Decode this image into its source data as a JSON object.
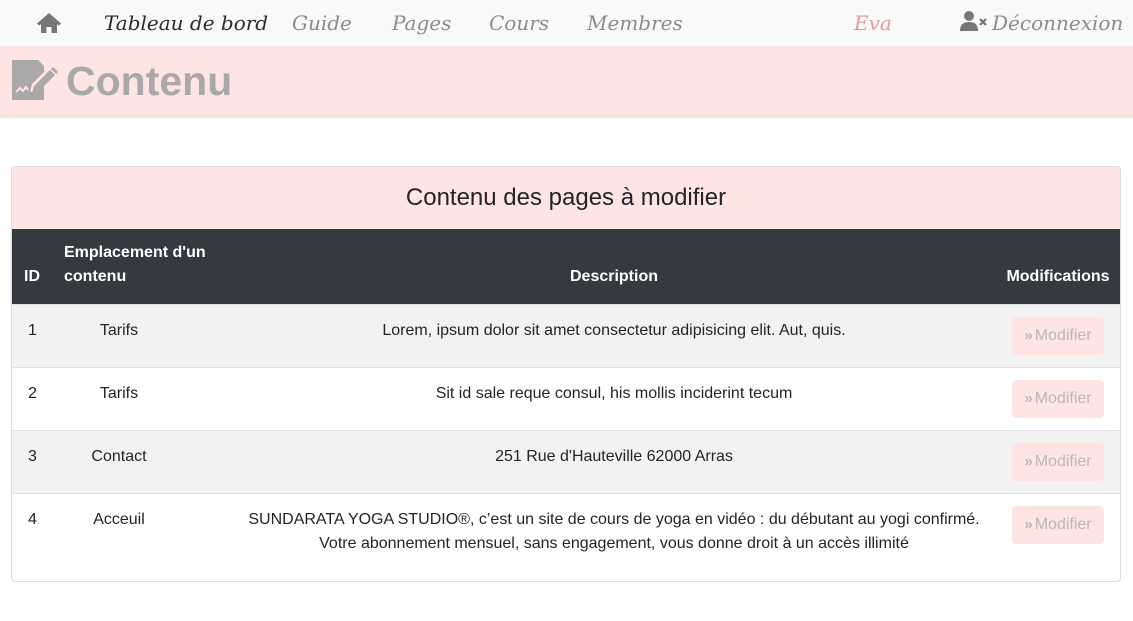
{
  "nav": {
    "home_icon": "home-icon",
    "items": [
      {
        "label": "Tableau de bord",
        "active": true
      },
      {
        "label": "Guide"
      },
      {
        "label": "Pages"
      },
      {
        "label": "Cours"
      },
      {
        "label": "Membres"
      }
    ],
    "user": "Eva",
    "logout_label": "Déconnexion",
    "logout_icon": "user-times-icon"
  },
  "header": {
    "title": "Contenu",
    "icon": "file-signature-icon"
  },
  "card": {
    "title": "Contenu des pages à modifier",
    "columns": [
      "ID",
      "Emplacement d'un contenu",
      "Description",
      "Modifications"
    ],
    "rows": [
      {
        "id": "1",
        "location": "Tarifs",
        "description": "Lorem, ipsum dolor sit amet consectetur adipisicing elit. Aut, quis.",
        "action": "Modifier"
      },
      {
        "id": "2",
        "location": "Tarifs",
        "description": "Sit id sale reque consul, his mollis inciderint tecum",
        "action": "Modifier"
      },
      {
        "id": "3",
        "location": "Contact",
        "description": "251 Rue d'Hauteville 62000 Arras",
        "action": "Modifier"
      },
      {
        "id": "4",
        "location": "Acceuil",
        "description": "SUNDARATA YOGA STUDIO®, c’est un site de cours de yoga en vidéo : du débutant au yogi confirmé. Votre abonnement mensuel, sans engagement, vous donne droit à un accès illimité",
        "action": "Modifier"
      }
    ]
  },
  "colors": {
    "navbar_bg": "#f8f9fa",
    "accent_pink": "#ffe4e4",
    "table_header_bg": "#343a40",
    "user_pink": "#e89a9a"
  }
}
